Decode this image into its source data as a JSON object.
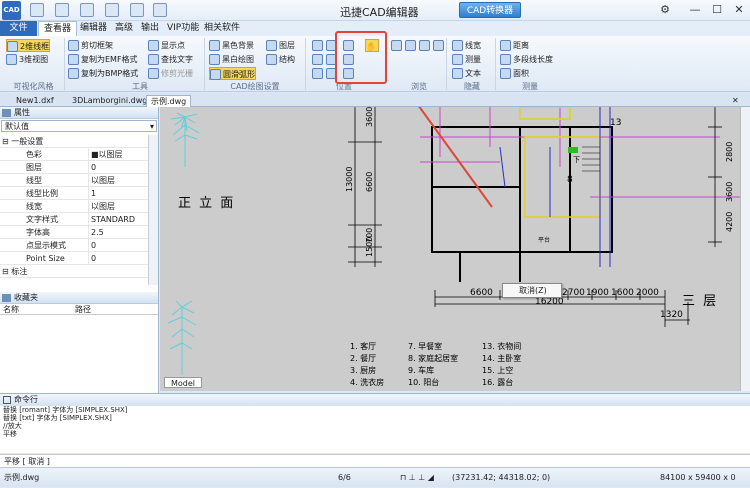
{
  "app": {
    "title": "迅捷CAD编辑器",
    "convert_button": "CAD转换器",
    "icon_label": "CAD"
  },
  "menu": {
    "items": [
      "文件",
      "查看器",
      "编辑器",
      "高级",
      "输出",
      "VIP功能",
      "相关软件"
    ]
  },
  "ribbon": {
    "view_style": {
      "btn1": "2维线框",
      "btn2": "3维视图",
      "label": "可视化风格"
    },
    "tools": {
      "items": [
        "剪切框架",
        "复制为EMF格式",
        "复制为BMP格式",
        "显示点",
        "查找文字",
        "修剪光栅"
      ],
      "label": "工具"
    },
    "cad_settings": {
      "items": [
        "黑色背景",
        "黑白绘图",
        "圆滑弧形",
        "图层",
        "结构"
      ],
      "label": "CAD绘图设置"
    },
    "position": {
      "label": "位置"
    },
    "browse": {
      "label": "浏览"
    },
    "hide": {
      "items": [
        "线宽",
        "测量",
        "文本"
      ],
      "label": "隐藏"
    },
    "measure": {
      "items": [
        "距离",
        "多段线长度",
        "面积"
      ],
      "label": "测量"
    }
  },
  "doc_tabs": [
    "New1.dxf",
    "3DLamborgini.dwg",
    "示例.dwg"
  ],
  "properties": {
    "title": "属性",
    "dropdown": "默认值",
    "rows": [
      {
        "k": "一般设置",
        "v": "",
        "section": true
      },
      {
        "k": "色彩",
        "v": "■以图层"
      },
      {
        "k": "图层",
        "v": "0"
      },
      {
        "k": "线型",
        "v": "以图层"
      },
      {
        "k": "线型比例",
        "v": "1"
      },
      {
        "k": "线宽",
        "v": "以图层"
      },
      {
        "k": "文字样式",
        "v": "STANDARD"
      },
      {
        "k": "字体高",
        "v": "2.5"
      },
      {
        "k": "点显示模式",
        "v": "0"
      },
      {
        "k": "Point Size",
        "v": "0"
      },
      {
        "k": "标注",
        "v": "",
        "section": true
      }
    ]
  },
  "favorites": {
    "title": "收藏夹",
    "col1": "名称",
    "col2": "路径"
  },
  "canvas": {
    "label_left": "正 立 面",
    "label_right": "三 层",
    "dims_v": [
      "3600",
      "13000",
      "6600",
      "1500",
      "700"
    ],
    "dims_v_right": [
      "2800",
      "3600",
      "4200"
    ],
    "dims_h": [
      "6600",
      "2700",
      "1900",
      "1600",
      "2000"
    ],
    "dim_total": "16200",
    "dim_1320": "1320",
    "room_13": "13",
    "room_8": "8",
    "room_down": "下",
    "room_balcony": "平台",
    "legend": [
      [
        "1. 客厅",
        "7. 早餐室",
        "13. 衣物间"
      ],
      [
        "2. 餐厅",
        "8. 家庭起居室",
        "14. 主卧室"
      ],
      [
        "3. 厨房",
        "9. 车库",
        "15. 上空"
      ],
      [
        "4. 洗衣房",
        "10. 阳台",
        "16. 露台"
      ]
    ],
    "model_tab": "Model",
    "context_menu": "取消(Z)"
  },
  "command": {
    "title": "命令行",
    "lines": [
      "替换 [romant] 字体为 [SIMPLEX.SHX]",
      "替换 [txt] 字体为 [SIMPLEX.SHX]",
      "//放大",
      "平移"
    ],
    "prompt": "平移 [ 取消 ]"
  },
  "status": {
    "file": "示例.dwg",
    "page": "6/6",
    "coords": "(37231.42; 44318.02; 0)",
    "size": "84100 x 59400 x 0"
  }
}
